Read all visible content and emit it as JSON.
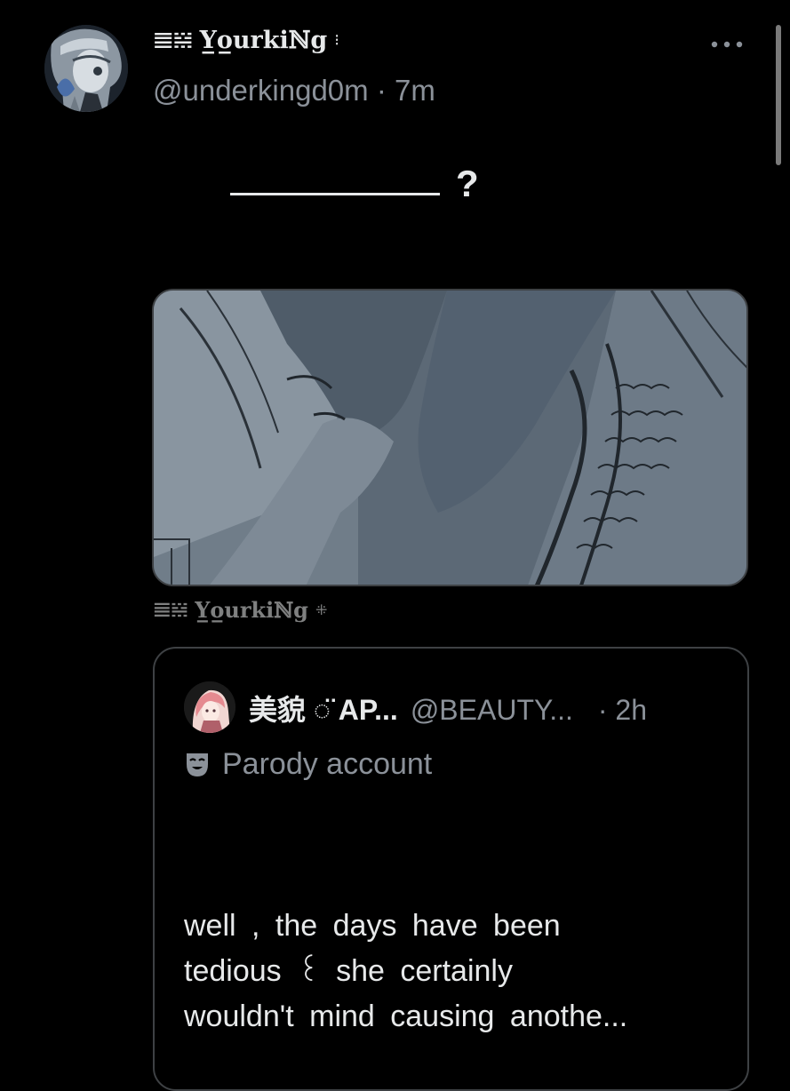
{
  "author": {
    "name_glyph": "𝌆𝍇",
    "display_name": "Y̲o̲urkiℕg",
    "name_tail": "⁝",
    "handle": "@underkingd0m",
    "separator": "·",
    "time": "7m"
  },
  "tweet": {
    "text": "?"
  },
  "signature": {
    "name_glyph": "𝌆𝍇",
    "display_name": "Y̲o̲urkiℕg",
    "name_tail": "⁜"
  },
  "quote": {
    "name": "美貌 ◌̈ AP...",
    "handle": "@BEAUTY...",
    "separator": "·",
    "time": "2h",
    "label": "Parody account",
    "body_lines": [
      "well , the days have been",
      "tedious  ꒰  she certainly",
      "wouldn't mind causing  anothe..."
    ]
  },
  "icons": {
    "more": "more-horizontal-icon",
    "parody": "theater-masks-icon"
  },
  "colors": {
    "background": "#000000",
    "primary_text": "#e7e9ea",
    "secondary_text": "#8b9199",
    "border": "#3e4144"
  }
}
